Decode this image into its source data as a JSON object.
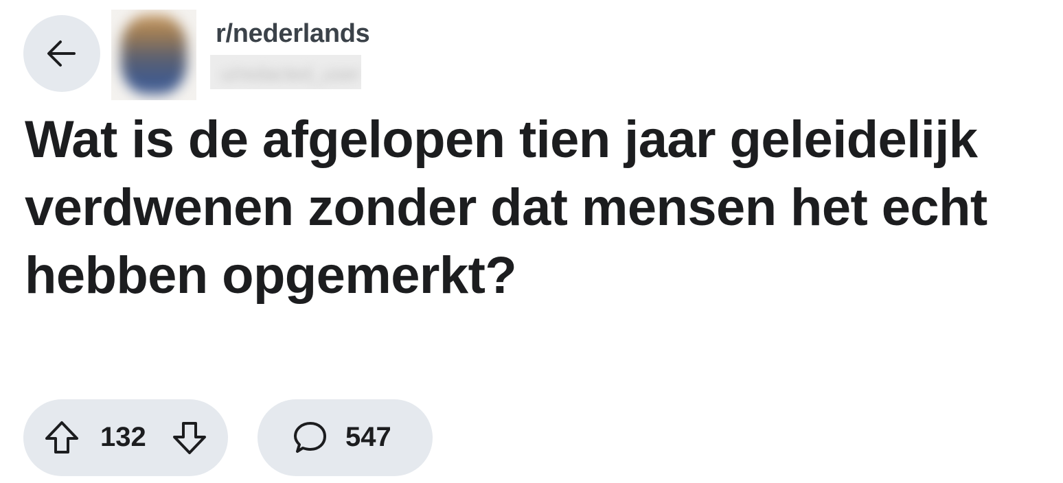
{
  "header": {
    "back_icon": "arrow-left-icon",
    "avatar_icon": "subreddit-avatar",
    "subreddit": "r/nederlands",
    "username": "u/redacted_user"
  },
  "post": {
    "title": "Wat is de afgelopen tien jaar geleidelijk verdwenen zonder dat mensen het echt hebben opgemerkt?"
  },
  "actions": {
    "upvote_icon": "arrow-up-outline-icon",
    "vote_count": "132",
    "downvote_icon": "arrow-down-outline-icon",
    "comment_icon": "speech-bubble-icon",
    "comment_count": "547"
  },
  "colors": {
    "pill_background": "#e5e9ee",
    "text": "#1c1d1f",
    "subreddit_text": "#3b4249"
  }
}
